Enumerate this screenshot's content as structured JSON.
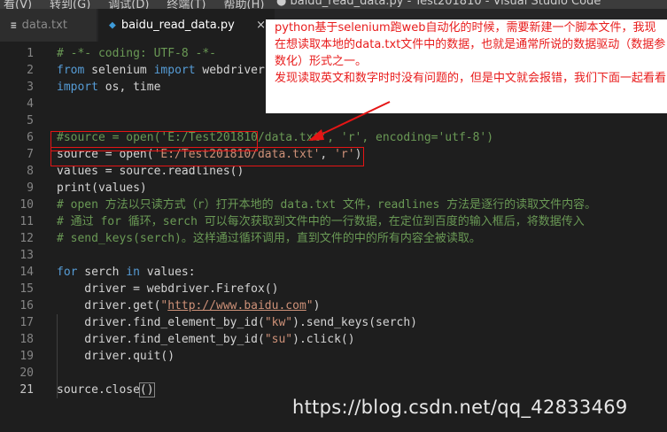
{
  "window": {
    "menu": [
      "看(V)",
      "转到(G)",
      "调试(D)",
      "终端(T)",
      "帮助(H)"
    ],
    "title": "● baidu_read_data.py - Test201810 - Visual Studio Code"
  },
  "tabs": [
    {
      "label": "data.txt",
      "icon": "txt-file-icon",
      "glyph": "≡"
    },
    {
      "label": "baidu_read_data.py",
      "icon": "python-file-icon",
      "glyph": "◆",
      "close": "×"
    }
  ],
  "line_numbers": [
    "1",
    "2",
    "3",
    "4",
    "5",
    "6",
    "7",
    "8",
    "9",
    "10",
    "11",
    "12",
    "13",
    "14",
    "15",
    "16",
    "17",
    "18",
    "19",
    "20",
    "21"
  ],
  "code": {
    "l1": "# -*- coding: UTF-8 -*-",
    "l2_kw": "from",
    "l2_a": " selenium ",
    "l2_kw2": "import",
    "l2_b": " webdriver",
    "l3_kw": "import",
    "l3_a": " os, time",
    "l6": "#source = open('E:/Test201810/data.txt', 'r', encoding='utf-8')",
    "l7_a": "source = open(",
    "l7_s1": "'E:/Test201810/data.txt'",
    "l7_b": ", ",
    "l7_s2": "'r'",
    "l7_c": ")",
    "l8": "values = source.readlines()",
    "l9": "print(values)",
    "l10": "# open 方法以只读方式（r）打开本地的 data.txt 文件，readlines 方法是逐行的读取文件内容。",
    "l11": "# 通过 for 循环，serch 可以每次获取到文件中的一行数据，在定位到百度的输入框后，将数据传入",
    "l12": "# send_keys(serch)。这样通过循环调用，直到文件的中的所有内容全被读取。",
    "l14_kw": "for",
    "l14_a": " serch ",
    "l14_kw2": "in",
    "l14_b": " values:",
    "l15": "    driver = webdriver.Firefox()",
    "l16_a": "    driver.get(",
    "l16_q1": "\"",
    "l16_url": "http://www.baidu.com",
    "l16_q2": "\"",
    "l16_b": ")",
    "l17_a": "    driver.find_element_by_id(",
    "l17_s": "\"kw\"",
    "l17_b": ").send_keys(serch)",
    "l18_a": "    driver.find_element_by_id(",
    "l18_s": "\"su\"",
    "l18_b": ").click()",
    "l19": "    driver.quit()",
    "l21_a": "source.close",
    "l21_b": "()"
  },
  "annotation": {
    "p1": "python基于selenium跑web自动化的时候，需要新建一个脚本文件，我现在想读取本地的data.txt文件中的数据，也就是通常所说的数据驱动（数据参数化）形式之一。",
    "p2": "发现读取英文和数字时时没有问题的，但是中文就会报错，我们下面一起看看"
  },
  "watermark": "https://blog.csdn.net/qq_42833469",
  "colors": {
    "editor_bg": "#1e1e1e",
    "keyword": "#569cd6",
    "comment": "#6a9955",
    "string": "#ce9178",
    "annotation_text": "#e81c1c",
    "highlight_box": "#e51515"
  }
}
